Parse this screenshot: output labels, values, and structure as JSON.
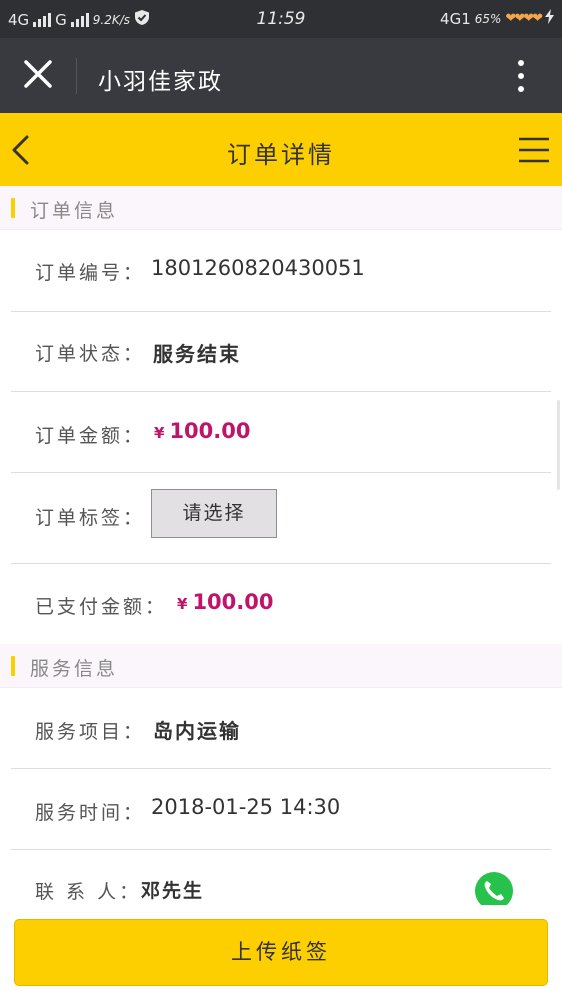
{
  "status_bar": {
    "network1": "4G",
    "network2": "G",
    "speed": "9.2K/s",
    "time": "11:59",
    "network3": "4G1",
    "battery": "65%"
  },
  "navbar": {
    "title": "小羽佳家政"
  },
  "header": {
    "title": "订单详情"
  },
  "order_section": {
    "title": "订单信息",
    "order_no_label": "订单编号：",
    "order_no": "1801260820430051",
    "status_label": "订单状态：",
    "status": "服务结束",
    "amount_label": "订单金额：",
    "currency": "¥",
    "amount": "100.00",
    "tag_label": "订单标签：",
    "tag_placeholder": "请选择",
    "paid_label": "已支付金额：",
    "paid_amount": "100.00"
  },
  "service_section": {
    "title": "服务信息",
    "item_label": "服务项目：",
    "item": "岛内运输",
    "time_label": "服务时间：",
    "time": "2018-01-25 14:30",
    "contact_label": "联 系 人：",
    "contact": "邓先生"
  },
  "footer": {
    "upload_label": "上传纸签"
  },
  "colors": {
    "accent": "#fdcf00",
    "price": "#c0146a",
    "navbar": "#393a3f",
    "phone": "#27c24c"
  }
}
